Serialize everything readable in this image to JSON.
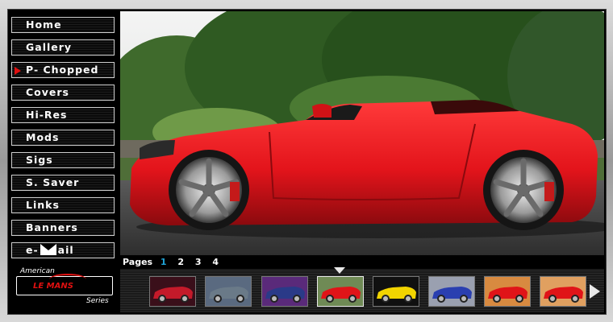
{
  "nav": {
    "items": [
      {
        "label": "Home"
      },
      {
        "label": "Gallery"
      },
      {
        "label": "P- Chopped"
      },
      {
        "label": "Covers"
      },
      {
        "label": "Hi-Res"
      },
      {
        "label": "Mods"
      },
      {
        "label": "Sigs"
      },
      {
        "label": "S. Saver"
      },
      {
        "label": "Links"
      },
      {
        "label": "Banners"
      }
    ],
    "active_index": 2,
    "email_prefix": "e-",
    "email_suffix": "ail"
  },
  "logo": {
    "american": "American",
    "brand": "LE MANS",
    "series": "Series"
  },
  "pager": {
    "label": "Pages",
    "pages": [
      "1",
      "2",
      "3",
      "4"
    ],
    "current": "1"
  },
  "thumbnails": [
    {
      "bg": "#3a0f1a",
      "car": "#c41a2a"
    },
    {
      "bg": "#5a6a80",
      "car": "#6a7a88"
    },
    {
      "bg": "#5a2a7a",
      "car": "#2a3a88"
    },
    {
      "bg": "#6f8a55",
      "car": "#e01418"
    },
    {
      "bg": "#101010",
      "car": "#f2d400"
    },
    {
      "bg": "#9aa0b0",
      "car": "#2a3fb0"
    },
    {
      "bg": "#d88a40",
      "car": "#e01418"
    },
    {
      "bg": "#e0a060",
      "car": "#e01418"
    }
  ],
  "selected_thumbnail": 3,
  "colors": {
    "accent_red": "#e01010",
    "page_current": "#1fa3d6",
    "car_red": "#e3141b"
  },
  "icons": {
    "nav_arrow": "red-arrow-icon",
    "email": "envelope-icon",
    "next": "next-arrow-icon",
    "pointer": "down-triangle-icon"
  }
}
